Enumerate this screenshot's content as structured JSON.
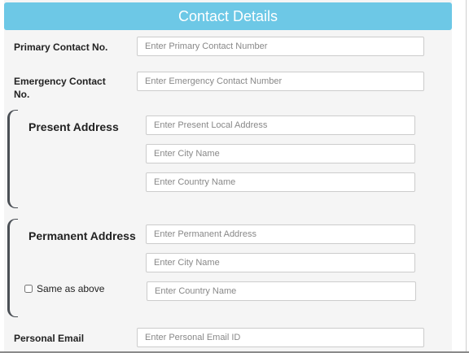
{
  "header": {
    "title": "Contact Details"
  },
  "primary_contact": {
    "label": "Primary Contact No.",
    "placeholder": "Enter Primary Contact Number"
  },
  "emergency_contact": {
    "label": "Emergency Contact No.",
    "placeholder": "Enter Emergency Contact Number"
  },
  "present_address": {
    "label": "Present Address",
    "address_placeholder": "Enter Present Local Address",
    "city_placeholder": "Enter City Name",
    "country_placeholder": "Enter Country Name"
  },
  "permanent_address": {
    "label": "Permanent Address",
    "address_placeholder": "Enter Permanent Address",
    "city_placeholder": "Enter City Name",
    "country_placeholder": "Enter Country Name",
    "same_as_above_label": "Same as above",
    "same_as_above_checked": false
  },
  "personal_email": {
    "label": "Personal Email",
    "placeholder": "Enter Personal Email ID"
  }
}
